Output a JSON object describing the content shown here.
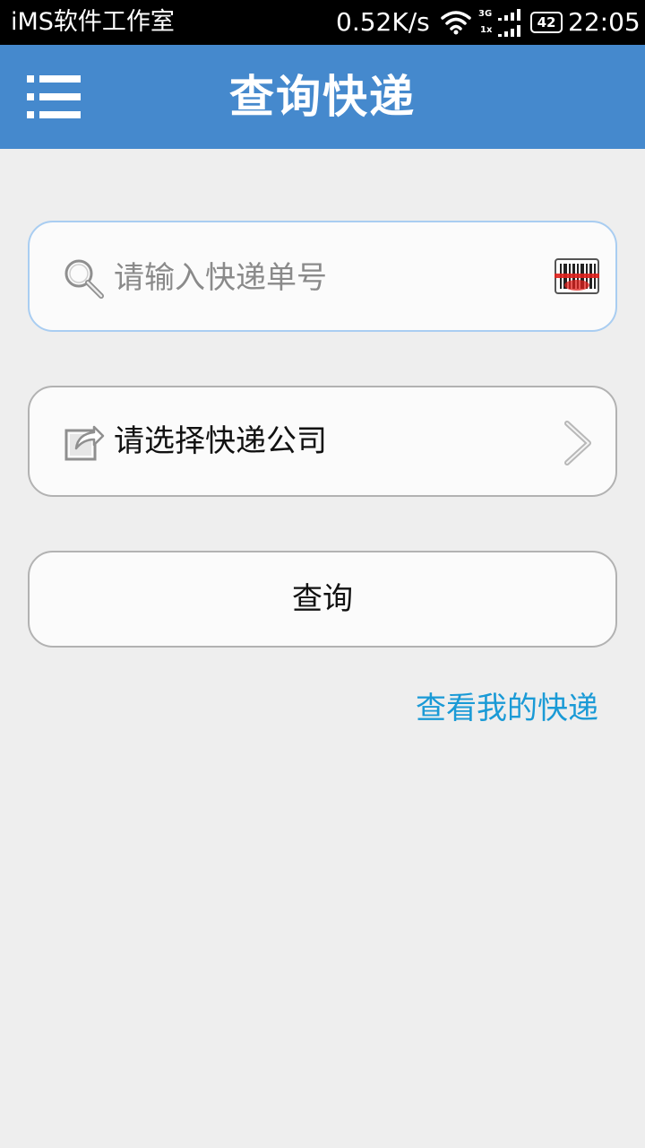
{
  "status_bar": {
    "carrier": "iMS软件工作室",
    "speed": "0.52K/s",
    "network_top": "3G",
    "network_bottom": "1x",
    "battery": "42",
    "time": "22:05"
  },
  "header": {
    "title": "查询快递"
  },
  "form": {
    "tracking_placeholder": "请输入快递单号",
    "tracking_value": "",
    "company_label": "请选择快递公司",
    "query_label": "查询"
  },
  "links": {
    "my_express": "查看我的快递"
  },
  "colors": {
    "header_bg": "#4589cd",
    "link": "#1a9ad6",
    "page_bg": "#eeeeee"
  }
}
